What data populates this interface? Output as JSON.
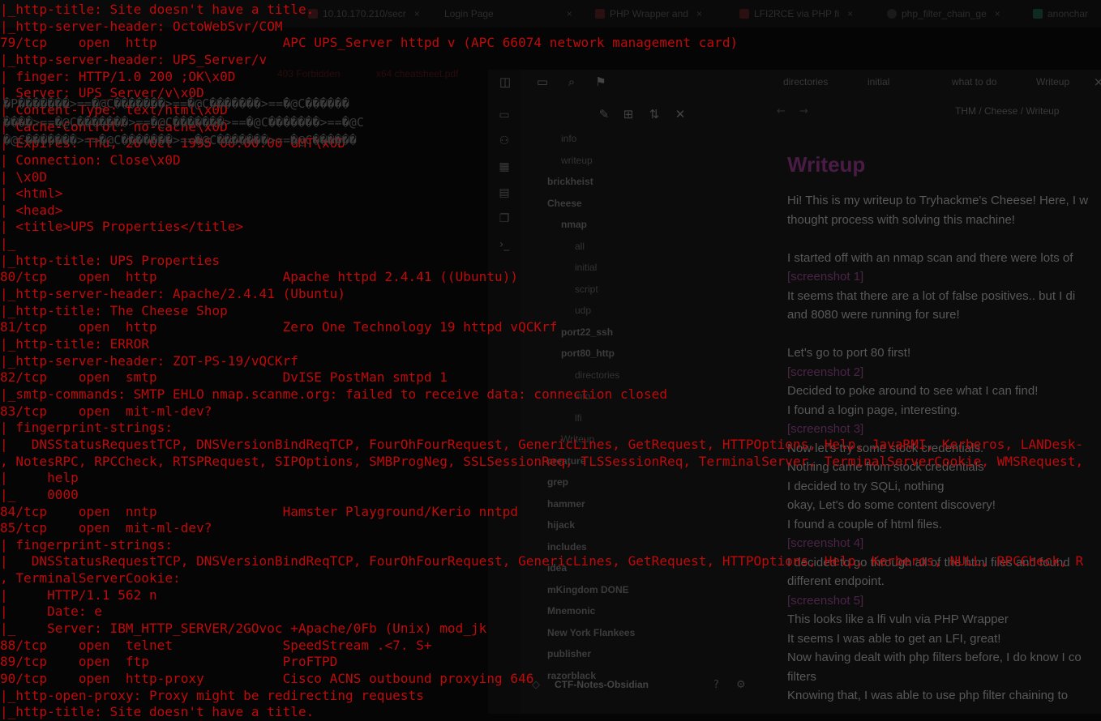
{
  "browser": {
    "tabs": [
      {
        "label": "10.10.170.210/secr",
        "close": "×"
      },
      {
        "label": "Login Page",
        "close": "×"
      },
      {
        "label": "PHP Wrapper and",
        "close": "×"
      },
      {
        "label": "LFI2RCE via PHP fi",
        "close": "×"
      },
      {
        "label": "php_filter_chain_ge",
        "close": "×"
      },
      {
        "label": "anonchar",
        "close": ""
      }
    ],
    "bookmarks": [
      {
        "label": "403 Forbidden"
      },
      {
        "label": "x64 cheatsheet.pdf"
      }
    ]
  },
  "obsidian": {
    "tabs": [
      "directories",
      "initial",
      "what to do",
      "Writeup"
    ],
    "breadcrumb": "THM  /  Cheese  /  Writeup",
    "file_tree": [
      {
        "label": "info",
        "type": "note"
      },
      {
        "label": "writeup",
        "type": "note"
      },
      {
        "label": "brickheist",
        "type": "folder"
      },
      {
        "label": "Cheese",
        "type": "folder"
      },
      {
        "label": "nmap",
        "type": "folder"
      },
      {
        "label": "all",
        "type": "note"
      },
      {
        "label": "initial",
        "type": "note"
      },
      {
        "label": "script",
        "type": "note"
      },
      {
        "label": "udp",
        "type": "note"
      },
      {
        "label": "port22_ssh",
        "type": "folder"
      },
      {
        "label": "port80_http",
        "type": "folder"
      },
      {
        "label": "directories",
        "type": "note"
      },
      {
        "label": "info",
        "type": "note"
      },
      {
        "label": "lfi",
        "type": "note"
      },
      {
        "label": "Writeup",
        "type": "note"
      },
      {
        "label": "creature",
        "type": "folder"
      },
      {
        "label": "grep",
        "type": "folder"
      },
      {
        "label": "hammer",
        "type": "folder"
      },
      {
        "label": "hijack",
        "type": "folder"
      },
      {
        "label": "includes",
        "type": "folder"
      },
      {
        "label": "idea",
        "type": "folder"
      },
      {
        "label": "mKingdom DONE",
        "type": "folder"
      },
      {
        "label": "Mnemonic",
        "type": "folder"
      },
      {
        "label": "New York Flankees",
        "type": "folder"
      },
      {
        "label": "publisher",
        "type": "folder"
      },
      {
        "label": "razorblack",
        "type": "folder"
      }
    ],
    "vault_name": "CTF-Notes-Obsidian",
    "note": {
      "title": "Writeup",
      "lines": [
        "Hi! This is my writeup to Tryhackme's Cheese! Here, I w",
        "thought process with solving this machine!",
        "",
        "I started off with an nmap scan and there were lots of",
        "[screenshot 1]",
        "It seems that there are a lot of false positives.. but I di",
        "and 8080 were running for sure!",
        "",
        "Let's go to port 80 first!",
        "[screenshot 2]",
        "Decided to poke around to see what I can find!",
        "I found a login page, interesting.",
        "[screenshot 3]",
        "Now let's try some stock credentials.",
        "Nothing came from stock credentials",
        "I decided to try SQLi, nothing",
        "okay, Let's do some content discovery!",
        "I found a couple of html files.",
        "[screenshot 4]",
        "I decided to go through all of the html files and found",
        "different endpoint.",
        "[screenshot 5]",
        "This looks like a lfi vuln via PHP Wrapper",
        "It seems I was able to get an LFI, great!",
        "Now having dealt with php filters before, I do know I co",
        "filters",
        "Knowing that, I was able to use php filter chaining to"
      ]
    }
  },
  "terminal": {
    "lines": [
      "|_http-title: Site doesn't have a title.",
      "|_http-server-header: OctoWebSvr/COM",
      "79/tcp    open  http                APC UPS_Server httpd v (APC 66074 network management card)",
      "|_http-server-header: UPS_Server/v",
      "| finger: HTTP/1.0 200 ;OK\\x0D",
      "| Server: UPS_Server/v\\x0D",
      "| Content-Type: text/html\\x0D",
      "| Cache-Control: no-cache\\x0D",
      "| Expires: Thu, 26 Oct 1995 00:00:00 GMT\\x0D",
      "| Connection: Close\\x0D",
      "| \\x0D",
      "| <html>",
      "| <head>",
      "| <title>UPS Properties</title>",
      "|_",
      "|_http-title: UPS Properties",
      "80/tcp    open  http                Apache httpd 2.4.41 ((Ubuntu))",
      "|_http-server-header: Apache/2.4.41 (Ubuntu)",
      "|_http-title: The Cheese Shop",
      "81/tcp    open  http                Zero One Technology 19 httpd vQCKrf",
      "|_http-title: ERROR",
      "|_http-server-header: ZOT-PS-19/vQCKrf",
      "82/tcp    open  smtp                DvISE PostMan smtpd 1",
      "|_smtp-commands: SMTP EHLO nmap.scanme.org: failed to receive data: connection closed",
      "83/tcp    open  mit-ml-dev?",
      "| fingerprint-strings:",
      "|   DNSStatusRequestTCP, DNSVersionBindReqTCP, FourOhFourRequest, GenericLines, GetRequest, HTTPOptions, Help, JavaRMI, Kerberos, LANDesk-",
      ", NotesRPC, RPCCheck, RTSPRequest, SIPOptions, SMBProgNeg, SSLSessionReq, TLSSessionReq, TerminalServer, TerminalServerCookie, WMSRequest,",
      "|     help",
      "|_    0000",
      "84/tcp    open  nntp                Hamster Playground/Kerio nntpd",
      "85/tcp    open  mit-ml-dev?",
      "| fingerprint-strings:",
      "|   DNSStatusRequestTCP, DNSVersionBindReqTCP, FourOhFourRequest, GenericLines, GetRequest, HTTPOptions, Help, Kerberos, NULL, RPCCheck, R",
      ", TerminalServerCookie:",
      "|     HTTP/1.1 562 n",
      "|     Date: e",
      "|_    Server: IBM_HTTP_SERVER/2GOvoc +Apache/0Fb (Unix) mod_jk",
      "88/tcp    open  telnet              SpeedStream .<7. S+",
      "89/tcp    open  ftp                 ProFTPD",
      "90/tcp    open  http-proxy          Cisco ACNS outbound proxying 646",
      "|_http-open-proxy: Proxy might be redirecting requests",
      "|_http-title: Site doesn't have a title."
    ],
    "garbled": [
      "�P�������>==�@C�������>==�@C�������>==�@C������",
      "����>==�@C�������>==�@C�������>==�@C�������>==�@C",
      "�@C�������>==�@C�������>==�@C�������>==�@C������"
    ]
  }
}
